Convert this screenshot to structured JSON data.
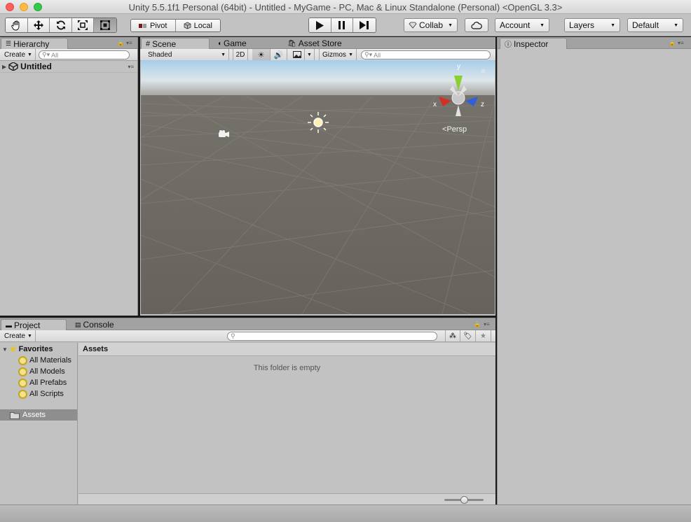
{
  "window": {
    "title": "Unity 5.5.1f1 Personal (64bit) - Untitled - MyGame - PC, Mac & Linux Standalone (Personal) <OpenGL 3.3>"
  },
  "toolbar": {
    "tools": [
      "hand-tool",
      "move-tool",
      "rotate-tool",
      "scale-tool",
      "rect-tool"
    ],
    "pivot_label": "Pivot",
    "local_label": "Local",
    "collab_label": "Collab",
    "account_label": "Account",
    "layers_label": "Layers",
    "layout_label": "Default"
  },
  "hierarchy": {
    "tab_label": "Hierarchy",
    "create_label": "Create",
    "search_placeholder": "All",
    "scene_name": "Untitled"
  },
  "scene": {
    "tabs": [
      "Scene",
      "Game",
      "Asset Store"
    ],
    "shading_mode": "Shaded",
    "mode_2d": "2D",
    "gizmos_label": "Gizmos",
    "search_placeholder": "All",
    "gizmo": {
      "x": "x",
      "y": "y",
      "z": "z",
      "projection": "Persp"
    }
  },
  "inspector": {
    "tab_label": "Inspector"
  },
  "project": {
    "tabs": [
      "Project",
      "Console"
    ],
    "create_label": "Create",
    "favorites_label": "Favorites",
    "favorites": [
      "All Materials",
      "All Models",
      "All Prefabs",
      "All Scripts"
    ],
    "assets_folder": "Assets",
    "breadcrumb": "Assets",
    "empty_message": "This folder is empty",
    "icon_size_fraction": 0.5
  },
  "colors": {
    "sky_top": "#9dc7e6",
    "ground": "#69655f",
    "panel_bg": "#c2c2c2",
    "selection": "#8e8e8e"
  }
}
